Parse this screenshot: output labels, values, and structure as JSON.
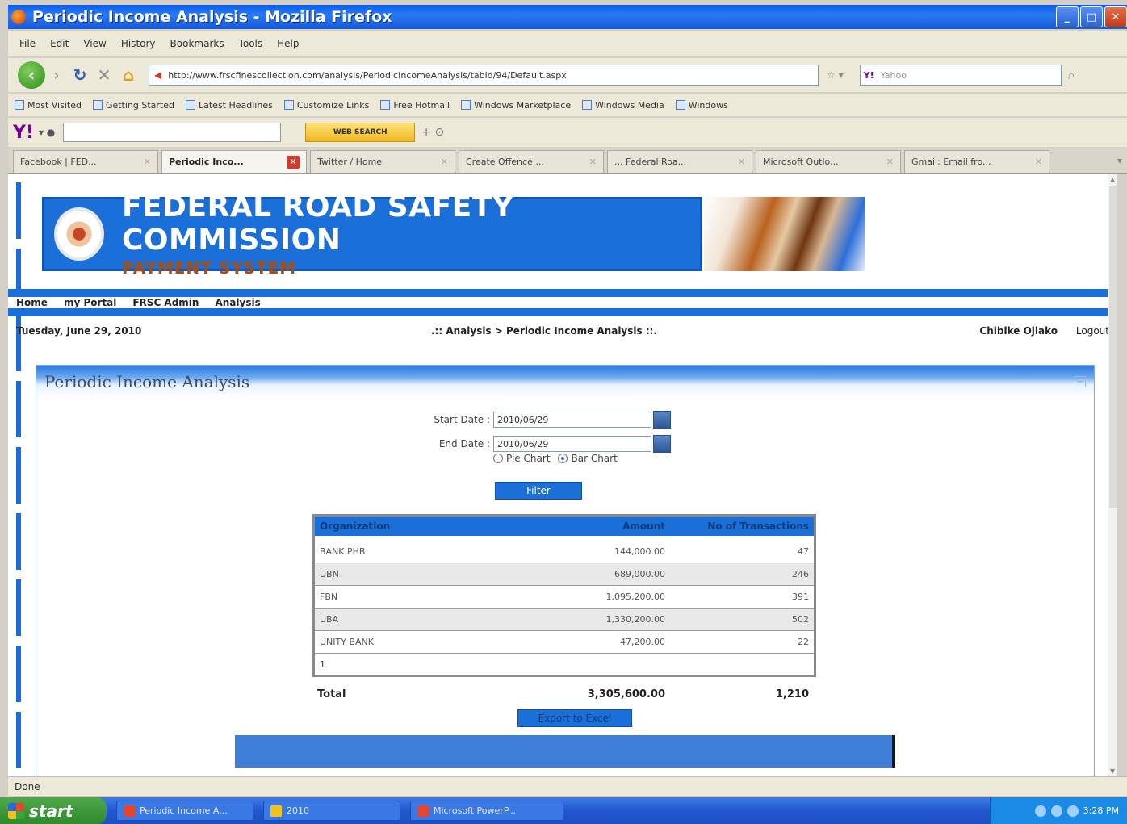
{
  "window": {
    "title": "Periodic Income Analysis - Mozilla Firefox"
  },
  "menu": [
    "File",
    "Edit",
    "View",
    "History",
    "Bookmarks",
    "Tools",
    "Help"
  ],
  "browser": {
    "url": "http://www.frscfinescollection.com/analysis/PeriodicIncomeAnalysis/tabid/94/Default.aspx",
    "search_placeholder": "Yahoo",
    "bookmarks": [
      "Most Visited",
      "Getting Started",
      "Latest Headlines",
      "Customize Links",
      "Free Hotmail",
      "Windows Marketplace",
      "Windows Media",
      "Windows"
    ],
    "yahoo_button": "WEB SEARCH",
    "tabs": [
      {
        "label": "Facebook | FED...",
        "active": false
      },
      {
        "label": "Periodic Inco...",
        "active": true
      },
      {
        "label": "Twitter / Home",
        "active": false
      },
      {
        "label": "Create Offence ...",
        "active": false
      },
      {
        "label": "... Federal Roa...",
        "active": false
      },
      {
        "label": "Microsoft Outlo...",
        "active": false
      },
      {
        "label": "Gmail: Email fro...",
        "active": false
      }
    ],
    "status": "Done"
  },
  "site": {
    "banner_title": "FEDERAL ROAD SAFETY COMMISSION",
    "banner_subtitle": "PAYMENT SYSTEM",
    "nav": [
      "Home",
      "my Portal",
      "FRSC Admin",
      "Analysis"
    ],
    "date": "Tuesday, June 29, 2010",
    "breadcrumb": ".:: Analysis > Periodic Income Analysis ::.",
    "user": "Chibike Ojiako",
    "logout": "Logout"
  },
  "panel": {
    "title": "Periodic Income Analysis",
    "start_date_label": "Start Date :",
    "start_date": "2010/06/29",
    "end_date_label": "End Date :",
    "end_date": "2010/06/29",
    "radio_pie": "Pie Chart",
    "radio_bar": "Bar Chart",
    "selected_chart": "Bar Chart",
    "filter_label": "Filter",
    "export_label": "Export to Excel"
  },
  "table": {
    "headers": [
      "Organization",
      "Amount",
      "No of Transactions"
    ],
    "rows": [
      [
        "BANK PHB",
        "144,000.00",
        "47"
      ],
      [
        "UBN",
        "689,000.00",
        "246"
      ],
      [
        "FBN",
        "1,095,200.00",
        "391"
      ],
      [
        "UBA",
        "1,330,200.00",
        "502"
      ],
      [
        "UNITY BANK",
        "47,200.00",
        "22"
      ]
    ],
    "pager": "1",
    "total_label": "Total",
    "total_amount": "3,305,600.00",
    "total_transactions": "1,210"
  },
  "taskbar": {
    "start": "start",
    "items": [
      "Periodic Income A...",
      "2010",
      "Microsoft PowerP..."
    ],
    "clock": "3:28 PM"
  }
}
